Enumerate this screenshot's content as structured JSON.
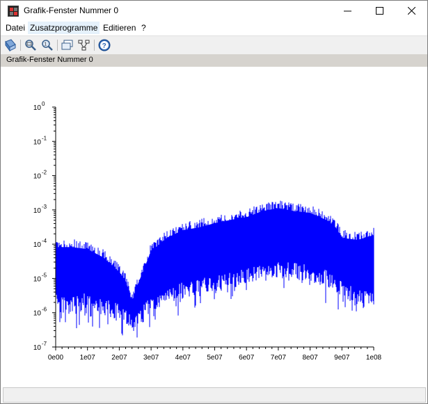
{
  "window": {
    "title": "Grafik-Fenster Nummer 0"
  },
  "menu": {
    "items": [
      {
        "label": "Datei"
      },
      {
        "label": "Zusatzprogramme"
      },
      {
        "label": "Editieren"
      },
      {
        "label": "?"
      }
    ]
  },
  "toolbar": {
    "buttons": [
      {
        "icon": "rotate-icon"
      },
      {
        "icon": "zoom-area-icon"
      },
      {
        "icon": "unzoom-icon"
      },
      {
        "icon": "figure-window-icon"
      },
      {
        "icon": "datatip-icon"
      },
      {
        "icon": "help-icon"
      }
    ]
  },
  "figure_label": "Grafik-Fenster Nummer 0",
  "colors": {
    "series": "#0000ff",
    "subtitle_bar": "#d6d3ce",
    "menu_hover": "#e5f1fb"
  },
  "chart_data": {
    "type": "area",
    "title": "",
    "xlabel": "",
    "ylabel": "",
    "xlim": [
      0,
      100000000
    ],
    "ylim": [
      1e-07,
      1
    ],
    "yscale": "log",
    "x_ticks": [
      "0e00",
      "1e07",
      "2e07",
      "3e07",
      "4e07",
      "5e07",
      "6e07",
      "7e07",
      "8e07",
      "9e07",
      "1e08"
    ],
    "y_ticks": [
      {
        "base": "10",
        "exp": "0"
      },
      {
        "base": "10",
        "exp": "-1"
      },
      {
        "base": "10",
        "exp": "-2"
      },
      {
        "base": "10",
        "exp": "-3"
      },
      {
        "base": "10",
        "exp": "-4"
      },
      {
        "base": "10",
        "exp": "-5"
      },
      {
        "base": "10",
        "exp": "-6"
      },
      {
        "base": "10",
        "exp": "-7"
      }
    ],
    "series": [
      {
        "color": "#0000ff",
        "x": [
          0,
          5000000,
          10000000,
          15000000,
          20000000,
          22000000,
          24000000,
          26000000,
          28000000,
          30000000,
          35000000,
          40000000,
          45000000,
          50000000,
          55000000,
          60000000,
          65000000,
          70000000,
          75000000,
          80000000,
          85000000,
          88000000,
          90000000,
          95000000,
          100000000
        ],
        "upper": [
          8e-05,
          8e-05,
          7e-05,
          4e-05,
          1.5e-05,
          8e-06,
          2e-06,
          7e-06,
          2e-05,
          6e-05,
          0.00015,
          0.00025,
          0.0003,
          0.0004,
          0.0005,
          0.0006,
          0.0009,
          0.0011,
          0.0009,
          0.0008,
          0.0005,
          0.0003,
          0.00015,
          0.00013,
          0.00018
        ],
        "lower": [
          5e-06,
          3e-06,
          4e-06,
          2.5e-06,
          2e-06,
          1.2e-06,
          8e-07,
          1e-06,
          2e-06,
          3e-06,
          5e-06,
          8e-06,
          1e-05,
          1.2e-05,
          1.5e-05,
          2e-05,
          2.5e-05,
          3e-05,
          3e-05,
          2.5e-05,
          1.8e-05,
          1.2e-05,
          8e-06,
          5e-06,
          4e-06
        ],
        "min": [
          6e-07,
          2e-07,
          3e-07,
          3e-07,
          2e-07,
          1e-07,
          1e-07,
          2e-07,
          3e-07,
          4e-07,
          6e-07,
          9e-07,
          1.2e-06,
          1.5e-06,
          2.2e-06,
          3e-06,
          4e-06,
          5e-06,
          5e-06,
          3e-06,
          1.5e-06,
          1e-06,
          8e-07,
          8e-07,
          9e-07
        ]
      }
    ]
  }
}
